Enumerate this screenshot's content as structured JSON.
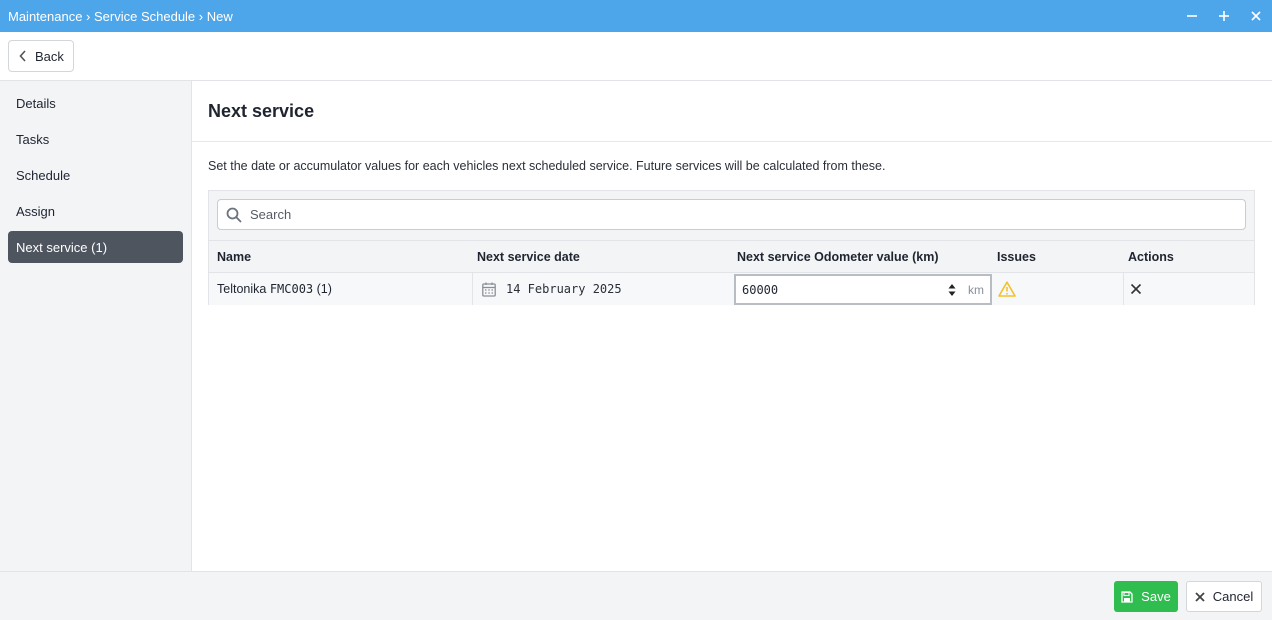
{
  "window": {
    "breadcrumb": "Maintenance › Service Schedule › New",
    "controls": [
      "minimize-icon",
      "maximize-icon",
      "close-icon"
    ]
  },
  "toolbar": {
    "back_label": "Back"
  },
  "sidebar": {
    "items": [
      {
        "label": "Details",
        "active": false
      },
      {
        "label": "Tasks",
        "active": false
      },
      {
        "label": "Schedule",
        "active": false
      },
      {
        "label": "Assign",
        "active": false
      },
      {
        "label": "Next service (1)",
        "active": true
      }
    ]
  },
  "main": {
    "title": "Next service",
    "description": "Set the date or accumulator values for each vehicles next scheduled service. Future services will be calculated from these.",
    "search": {
      "placeholder": "Search",
      "value": ""
    },
    "table": {
      "columns": [
        "Name",
        "Next service date",
        "Next service Odometer value (km)",
        "Issues",
        "Actions"
      ],
      "rows": [
        {
          "name_prefix": "Teltonika ",
          "name_code": "FMC003",
          "name_suffix": " (1)",
          "next_service_date": "14 February 2025",
          "odometer_value": "60000",
          "odometer_unit": "km",
          "issue_icon": "warning-icon",
          "action_icon": "close-icon"
        }
      ]
    }
  },
  "footer": {
    "save_label": "Save",
    "cancel_label": "Cancel"
  },
  "colors": {
    "titlebar": "#4ea6ea",
    "save": "#2ebd4e",
    "active_nav": "#4f555f",
    "warning": "#f2c12e"
  }
}
